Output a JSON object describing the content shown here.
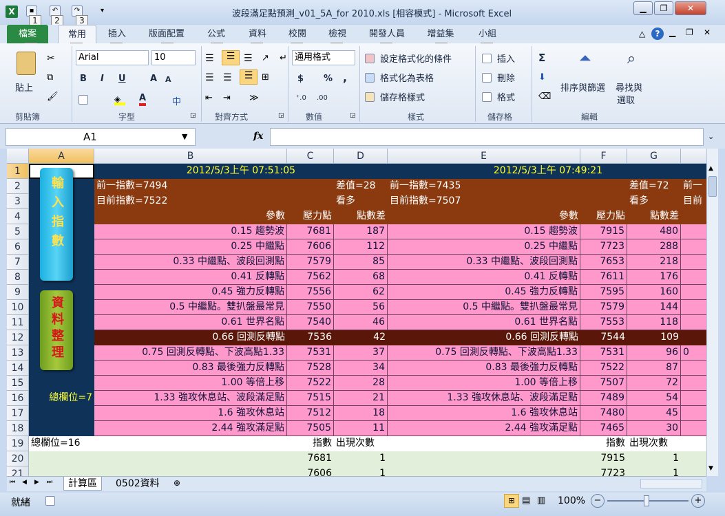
{
  "window": {
    "title": "波段滿足點預測_v01_5A_for 2010.xls  [相容模式]  -  Microsoft Excel",
    "minimize": "▁",
    "restore": "❐",
    "close": "✕"
  },
  "qat": {
    "keytips": [
      "1",
      "2",
      "3"
    ]
  },
  "tabs": [
    {
      "label": "檔案",
      "key": "F"
    },
    {
      "label": "常用",
      "key": "H"
    },
    {
      "label": "插入",
      "key": "N"
    },
    {
      "label": "版面配置",
      "key": "P"
    },
    {
      "label": "公式",
      "key": "M"
    },
    {
      "label": "資料",
      "key": "A"
    },
    {
      "label": "校閱",
      "key": "R"
    },
    {
      "label": "檢視",
      "key": "W"
    },
    {
      "label": "開發人員",
      "key": "L"
    },
    {
      "label": "增益集",
      "key": "X"
    },
    {
      "label": "小組",
      "key": "Y"
    }
  ],
  "ribbon": {
    "clipboard": {
      "paste": "貼上",
      "label": "剪貼簿"
    },
    "font": {
      "name": "Arial",
      "size": "10",
      "label": "字型",
      "bold": "B",
      "italic": "I",
      "underline": "U",
      "grow": "A",
      "shrink": "A",
      "color_a": "A",
      "wen": "中"
    },
    "align": {
      "label": "對齊方式"
    },
    "number": {
      "format": "通用格式",
      "label": "數值",
      "currency": "$",
      "percent": "%",
      "comma": ",",
      "inc": "⁺.0",
      "dec": ".00"
    },
    "styles": {
      "cond": "設定格式化的條件",
      "table": "格式化為表格",
      "cell": "儲存格樣式",
      "label": "樣式"
    },
    "cells": {
      "insert": "插入",
      "delete": "刪除",
      "format": "格式",
      "label": "儲存格"
    },
    "editing": {
      "sum": "Σ",
      "sort": "排序與篩選",
      "find": "尋找與",
      "select": "選取",
      "label": "編輯"
    }
  },
  "formula_bar": {
    "name_box": "A1",
    "fx": "fx",
    "value": ""
  },
  "columns": [
    "A",
    "B",
    "C",
    "D",
    "E",
    "F",
    "G"
  ],
  "rows": [
    "1",
    "2",
    "3",
    "4",
    "5",
    "6",
    "7",
    "8",
    "9",
    "10",
    "11",
    "12",
    "13",
    "14",
    "15",
    "16",
    "17",
    "18",
    "19",
    "20",
    "21"
  ],
  "buttons": {
    "input": "輸入指數",
    "organize": "資料整理"
  },
  "total_cols_a": "總欄位=7",
  "total_cols_19": "總欄位=16",
  "left": {
    "timestamp": "2012/5/3上午 07:51:05",
    "prev": "前一指數=7494",
    "curr": "目前指數=7522",
    "diff": "差值=28",
    "view": "看多",
    "head": [
      "參數",
      "壓力點",
      "點數差"
    ],
    "rows": [
      [
        "0.15 趨勢波",
        "7681",
        "187"
      ],
      [
        "0.25 中繼點",
        "7606",
        "112"
      ],
      [
        "0.33 中繼點、波段回測點",
        "7579",
        "85"
      ],
      [
        "0.41 反轉點",
        "7562",
        "68"
      ],
      [
        "0.45 強力反轉點",
        "7556",
        "62"
      ],
      [
        "0.5  中繼點。雙扒盤最常見",
        "7550",
        "56"
      ],
      [
        "0.61 世界名點",
        "7540",
        "46"
      ],
      [
        "0.66 回測反轉點",
        "7536",
        "42"
      ],
      [
        "0.75 回測反轉點、下波高點1.33",
        "7531",
        "37"
      ],
      [
        "0.83 最後強力反轉點",
        "7528",
        "34"
      ],
      [
        "1.00 等倍上移",
        "7522",
        "28"
      ],
      [
        "1.33 強攻休息站、波段滿足點",
        "7515",
        "21"
      ],
      [
        "1.6  強攻休息站",
        "7512",
        "18"
      ],
      [
        "2.44 強攻滿足點",
        "7505",
        "11"
      ]
    ],
    "count_head": [
      "指數",
      "出現次數"
    ],
    "count_rows": [
      [
        "7681",
        "1"
      ],
      [
        "7606",
        "1"
      ]
    ]
  },
  "right": {
    "timestamp": "2012/5/3上午 07:49:21",
    "prev": "前一指數=7435",
    "curr": "目前指數=7507",
    "diff": "差值=72",
    "view": "看多",
    "head": [
      "參數",
      "壓力點",
      "點數差"
    ],
    "rows": [
      [
        "0.15 趨勢波",
        "7915",
        "480"
      ],
      [
        "0.25 中繼點",
        "7723",
        "288"
      ],
      [
        "0.33 中繼點、波段回測點",
        "7653",
        "218"
      ],
      [
        "0.41 反轉點",
        "7611",
        "176"
      ],
      [
        "0.45 強力反轉點",
        "7595",
        "160"
      ],
      [
        "0.5  中繼點。雙扒盤最常見",
        "7579",
        "144"
      ],
      [
        "0.61 世界名點",
        "7553",
        "118"
      ],
      [
        "0.66 回測反轉點",
        "7544",
        "109"
      ],
      [
        "0.75 回測反轉點、下波高點1.33",
        "7531",
        "96"
      ],
      [
        "0.83 最後強力反轉點",
        "7522",
        "87"
      ],
      [
        "1.00 等倍上移",
        "7507",
        "72"
      ],
      [
        "1.33 強攻休息站、波段滿足點",
        "7489",
        "54"
      ],
      [
        "1.6  強攻休息站",
        "7480",
        "45"
      ],
      [
        "2.44 強攻滿足點",
        "7465",
        "30"
      ]
    ],
    "count_head": [
      "指數",
      "出現次數"
    ],
    "count_rows": [
      [
        "7915",
        "1"
      ],
      [
        "7723",
        "1"
      ]
    ]
  },
  "overflow": {
    "prev": "前一",
    "curr": "目前",
    "r13": "0"
  },
  "sheet_tabs": [
    "計算區",
    "0502資料"
  ],
  "status": {
    "ready": "就緒",
    "zoom": "100%"
  }
}
